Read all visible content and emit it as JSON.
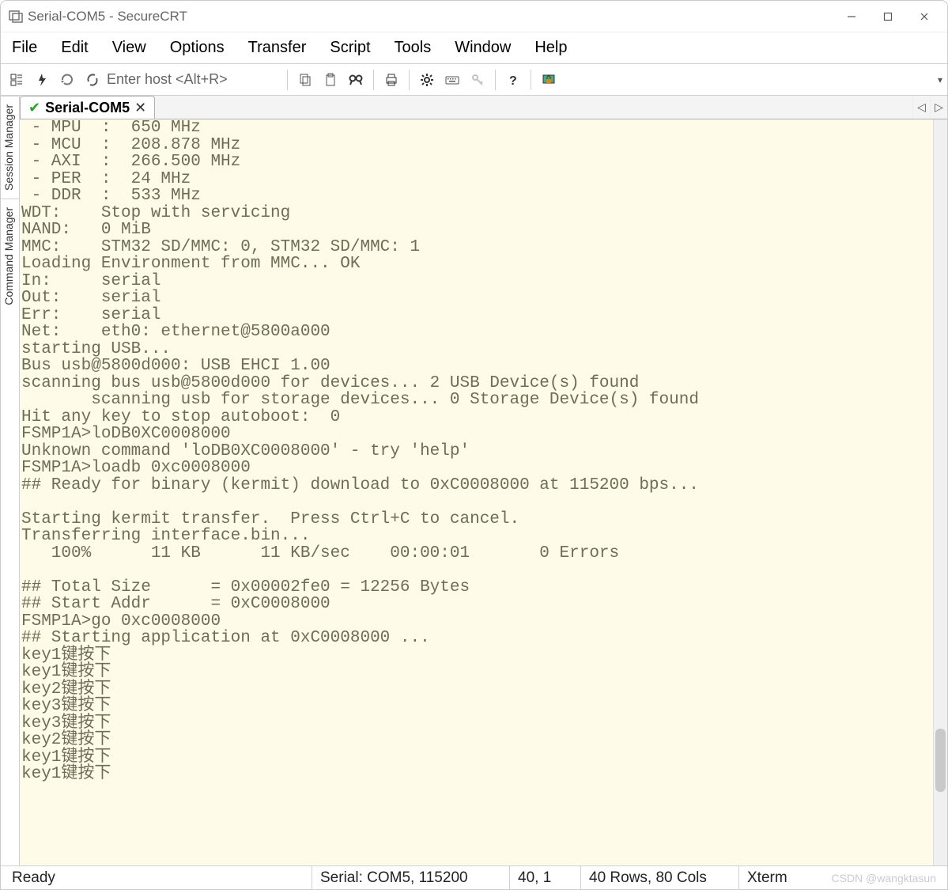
{
  "titlebar": {
    "title": "Serial-COM5 - SecureCRT"
  },
  "menubar": {
    "items": [
      "File",
      "Edit",
      "View",
      "Options",
      "Transfer",
      "Script",
      "Tools",
      "Window",
      "Help"
    ]
  },
  "toolbar": {
    "host_placeholder": "Enter host <Alt+R>"
  },
  "side_panels": {
    "session": "Session Manager",
    "command": "Command Manager"
  },
  "tab": {
    "label": "Serial-COM5"
  },
  "terminal_lines": [
    " - MPU  :  650 MHz",
    " - MCU  :  208.878 MHz",
    " - AXI  :  266.500 MHz",
    " - PER  :  24 MHz",
    " - DDR  :  533 MHz",
    "WDT:    Stop with servicing",
    "NAND:   0 MiB",
    "MMC:    STM32 SD/MMC: 0, STM32 SD/MMC: 1",
    "Loading Environment from MMC... OK",
    "In:     serial",
    "Out:    serial",
    "Err:    serial",
    "Net:    eth0: ethernet@5800a000",
    "starting USB...",
    "Bus usb@5800d000: USB EHCI 1.00",
    "scanning bus usb@5800d000 for devices... 2 USB Device(s) found",
    "       scanning usb for storage devices... 0 Storage Device(s) found",
    "Hit any key to stop autoboot:  0",
    "FSMP1A>loDB0XC0008000",
    "Unknown command 'loDB0XC0008000' - try 'help'",
    "FSMP1A>loadb 0xc0008000",
    "## Ready for binary (kermit) download to 0xC0008000 at 115200 bps...",
    "",
    "Starting kermit transfer.  Press Ctrl+C to cancel.",
    "Transferring interface.bin...",
    "   100%      11 KB      11 KB/sec    00:00:01       0 Errors",
    "",
    "## Total Size      = 0x00002fe0 = 12256 Bytes",
    "## Start Addr      = 0xC0008000",
    "FSMP1A>go 0xc0008000",
    "## Starting application at 0xC0008000 ...",
    "key1键按下",
    "key1键按下",
    "key2键按下",
    "key3键按下",
    "key3键按下",
    "key2键按下",
    "key1键按下",
    "key1键按下",
    ""
  ],
  "statusbar": {
    "ready": "Ready",
    "serial": "Serial: COM5, 115200",
    "pos": "40,   1",
    "rowscols": "40 Rows, 80 Cols",
    "emul": "Xterm",
    "watermark": "CSDN @wangktasun"
  }
}
